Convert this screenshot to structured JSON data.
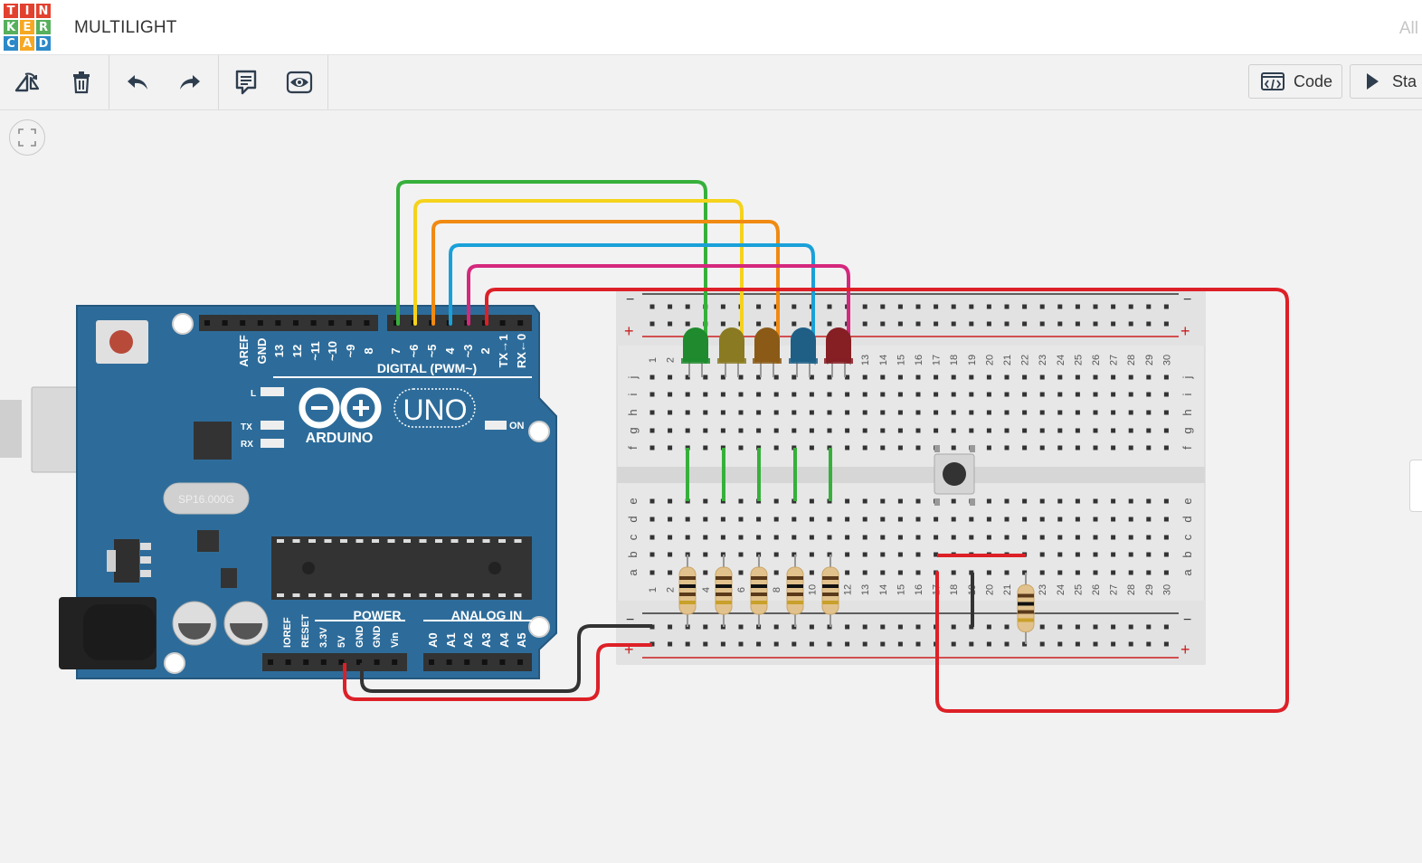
{
  "app": {
    "logo_letters": [
      "T",
      "I",
      "N",
      "K",
      "E",
      "R",
      "C",
      "A",
      "D"
    ],
    "logo_colors": [
      "#e2412f",
      "#e2412f",
      "#e2412f",
      "#57b05c",
      "#f6a823",
      "#57b05c",
      "#2c89c8",
      "#f6a823",
      "#2c89c8"
    ],
    "title": "MULTILIGHT",
    "top_right": "All"
  },
  "toolbar": {
    "icons": [
      "rotate-icon",
      "delete-icon",
      "undo-icon",
      "redo-icon",
      "notes-icon",
      "visibility-icon"
    ],
    "code_label": "Code",
    "start_label": "Sta"
  },
  "arduino": {
    "brand": "ARDUINO",
    "model": "UNO",
    "digital_label": "DIGITAL (PWM~)",
    "power_label": "POWER",
    "analog_label": "ANALOG IN",
    "crystal_label": "SP16.000G",
    "led_labels": {
      "l": "L",
      "tx": "TX",
      "rx": "RX",
      "on": "ON"
    },
    "digital_pins": [
      "AREF",
      "GND",
      "13",
      "12",
      "~11",
      "~10",
      "~9",
      "8",
      "7",
      "~6",
      "~5",
      "4",
      "~3",
      "2",
      "TX→1",
      "RX←0"
    ],
    "power_pins": [
      "IOREF",
      "RESET",
      "3.3V",
      "5V",
      "GND",
      "GND",
      "Vin"
    ],
    "analog_pins": [
      "A0",
      "A1",
      "A2",
      "A3",
      "A4",
      "A5"
    ]
  },
  "breadboard": {
    "rows_top": [
      "j",
      "i",
      "h",
      "g",
      "f"
    ],
    "rows_bottom": [
      "e",
      "d",
      "c",
      "b",
      "a"
    ],
    "minus": "−",
    "plus": "+",
    "col_numbers": [
      "1",
      "2",
      "3",
      "4",
      "5",
      "6",
      "7",
      "8",
      "9",
      "10",
      "11",
      "12",
      "13",
      "14",
      "15",
      "16",
      "17",
      "18",
      "19",
      "20",
      "21",
      "22",
      "23",
      "24",
      "25",
      "26",
      "27",
      "28",
      "29",
      "30"
    ]
  },
  "components": {
    "leds": [
      {
        "color": "green",
        "hex": "#1f8a2e"
      },
      {
        "color": "yellow",
        "hex": "#8a7a22"
      },
      {
        "color": "orange",
        "hex": "#8a5a16"
      },
      {
        "color": "blue",
        "hex": "#1f5f86"
      },
      {
        "color": "red",
        "hex": "#851f24"
      }
    ],
    "wires": [
      {
        "color": "#36b03b",
        "from": "7"
      },
      {
        "color": "#f5d21c",
        "from": "~6"
      },
      {
        "color": "#f08a12",
        "from": "~5"
      },
      {
        "color": "#1aa0d8",
        "from": "4"
      },
      {
        "color": "#d4287d",
        "from": "~3"
      },
      {
        "color": "#dd2027",
        "from": "2"
      }
    ],
    "resistor_count": 6,
    "pushbutton_count": 1
  }
}
